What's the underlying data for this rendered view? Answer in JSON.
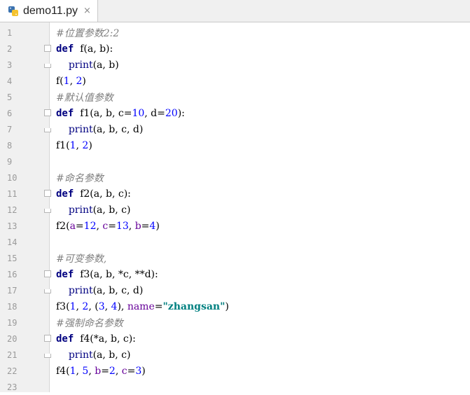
{
  "tab": {
    "title": "demo11.py",
    "icon": "python-file-icon",
    "close_glyph": "×"
  },
  "lines": [
    [
      {
        "t": "#位置参数",
        "c": "c-comment"
      },
      {
        "t": "2:2",
        "c": "c-comment"
      }
    ],
    [
      {
        "t": "def",
        "c": "c-kw"
      },
      {
        "t": "  f(a, b):",
        "c": ""
      }
    ],
    [
      {
        "t": "    ",
        "c": ""
      },
      {
        "t": "print",
        "c": "c-builtin"
      },
      {
        "t": "(a, b)",
        "c": ""
      }
    ],
    [
      {
        "t": "f(",
        "c": ""
      },
      {
        "t": "1",
        "c": "c-num"
      },
      {
        "t": ", ",
        "c": ""
      },
      {
        "t": "2",
        "c": "c-num"
      },
      {
        "t": ")",
        "c": ""
      }
    ],
    [
      {
        "t": "#默认值参数",
        "c": "c-comment"
      }
    ],
    [
      {
        "t": "def",
        "c": "c-kw"
      },
      {
        "t": "  f1(a, b, c=",
        "c": ""
      },
      {
        "t": "10",
        "c": "c-num"
      },
      {
        "t": ", d=",
        "c": ""
      },
      {
        "t": "20",
        "c": "c-num"
      },
      {
        "t": "):",
        "c": ""
      }
    ],
    [
      {
        "t": "    ",
        "c": ""
      },
      {
        "t": "print",
        "c": "c-builtin"
      },
      {
        "t": "(a, b, c, d)",
        "c": ""
      }
    ],
    [
      {
        "t": "f1(",
        "c": ""
      },
      {
        "t": "1",
        "c": "c-num"
      },
      {
        "t": ", ",
        "c": ""
      },
      {
        "t": "2",
        "c": "c-num"
      },
      {
        "t": ")",
        "c": ""
      }
    ],
    [],
    [
      {
        "t": "#命名参数",
        "c": "c-comment"
      }
    ],
    [
      {
        "t": "def",
        "c": "c-kw"
      },
      {
        "t": "  f2(a, b, c):",
        "c": ""
      }
    ],
    [
      {
        "t": "    ",
        "c": ""
      },
      {
        "t": "print",
        "c": "c-builtin"
      },
      {
        "t": "(a, b, c)",
        "c": ""
      }
    ],
    [
      {
        "t": "f2(",
        "c": ""
      },
      {
        "t": "a",
        "c": "c-kwarg"
      },
      {
        "t": "=",
        "c": ""
      },
      {
        "t": "12",
        "c": "c-num"
      },
      {
        "t": ", ",
        "c": ""
      },
      {
        "t": "c",
        "c": "c-kwarg"
      },
      {
        "t": "=",
        "c": ""
      },
      {
        "t": "13",
        "c": "c-num"
      },
      {
        "t": ", ",
        "c": ""
      },
      {
        "t": "b",
        "c": "c-kwarg"
      },
      {
        "t": "=",
        "c": ""
      },
      {
        "t": "4",
        "c": "c-num"
      },
      {
        "t": ")",
        "c": ""
      }
    ],
    [],
    [
      {
        "t": "#可变参数,",
        "c": "c-comment"
      }
    ],
    [
      {
        "t": "def",
        "c": "c-kw"
      },
      {
        "t": "  f3(a, b, *c, **d):",
        "c": ""
      }
    ],
    [
      {
        "t": "    ",
        "c": ""
      },
      {
        "t": "print",
        "c": "c-builtin"
      },
      {
        "t": "(a, b, c, d)",
        "c": ""
      }
    ],
    [
      {
        "t": "f3(",
        "c": ""
      },
      {
        "t": "1",
        "c": "c-num"
      },
      {
        "t": ", ",
        "c": ""
      },
      {
        "t": "2",
        "c": "c-num"
      },
      {
        "t": ", (",
        "c": ""
      },
      {
        "t": "3",
        "c": "c-num"
      },
      {
        "t": ", ",
        "c": ""
      },
      {
        "t": "4",
        "c": "c-num"
      },
      {
        "t": "), ",
        "c": ""
      },
      {
        "t": "name",
        "c": "c-kwarg"
      },
      {
        "t": "=",
        "c": ""
      },
      {
        "t": "\"zhangsan\"",
        "c": "c-str"
      },
      {
        "t": ")",
        "c": ""
      }
    ],
    [
      {
        "t": "#强制命名参数",
        "c": "c-comment"
      }
    ],
    [
      {
        "t": "def",
        "c": "c-kw"
      },
      {
        "t": "  f4(*a, b, c):",
        "c": ""
      }
    ],
    [
      {
        "t": "    ",
        "c": ""
      },
      {
        "t": "print",
        "c": "c-builtin"
      },
      {
        "t": "(a, b, c)",
        "c": ""
      }
    ],
    [
      {
        "t": "f4(",
        "c": ""
      },
      {
        "t": "1",
        "c": "c-num"
      },
      {
        "t": ", ",
        "c": ""
      },
      {
        "t": "5",
        "c": "c-num"
      },
      {
        "t": ", ",
        "c": ""
      },
      {
        "t": "b",
        "c": "c-kwarg"
      },
      {
        "t": "=",
        "c": ""
      },
      {
        "t": "2",
        "c": "c-num"
      },
      {
        "t": ", ",
        "c": ""
      },
      {
        "t": "c",
        "c": "c-kwarg"
      },
      {
        "t": "=",
        "c": ""
      },
      {
        "t": "3",
        "c": "c-num"
      },
      {
        "t": ")",
        "c": ""
      }
    ],
    []
  ],
  "fold_start_lines": [
    2,
    6,
    11,
    16,
    20
  ],
  "fold_end_lines": [
    3,
    7,
    12,
    17,
    21
  ],
  "line_numbers": [
    "1",
    "2",
    "3",
    "4",
    "5",
    "6",
    "7",
    "8",
    "9",
    "10",
    "11",
    "12",
    "13",
    "14",
    "15",
    "16",
    "17",
    "18",
    "19",
    "20",
    "21",
    "22",
    "23"
  ],
  "colors": {
    "keyword": "#000080",
    "number": "#0000ff",
    "comment": "#808080",
    "kwarg": "#660099",
    "string": "#008080",
    "gutter": "#f0f0f0"
  }
}
